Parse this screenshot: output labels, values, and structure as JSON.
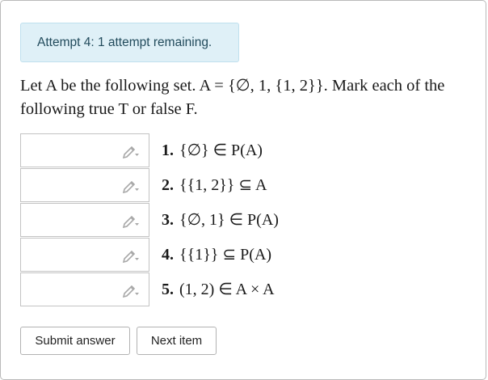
{
  "alert": {
    "text": "Attempt 4: 1 attempt remaining."
  },
  "prompt": {
    "text": "Let A be the following set. A = {∅, 1, {1, 2}}. Mark each of the following true T or false F."
  },
  "answers": [
    {
      "number": "1.",
      "statement": "{∅} ∈ P(A)",
      "value": "",
      "icon": "pencil-icon"
    },
    {
      "number": "2.",
      "statement": "{{1, 2}} ⊆ A",
      "value": "",
      "icon": "pencil-icon"
    },
    {
      "number": "3.",
      "statement": "{∅, 1} ∈ P(A)",
      "value": "",
      "icon": "pencil-icon"
    },
    {
      "number": "4.",
      "statement": "{{1}} ⊆ P(A)",
      "value": "",
      "icon": "pencil-icon"
    },
    {
      "number": "5.",
      "statement": "(1, 2) ∈ A × A",
      "value": "",
      "icon": "pencil-icon"
    }
  ],
  "buttons": {
    "submit_label": "Submit answer",
    "next_label": "Next item"
  }
}
